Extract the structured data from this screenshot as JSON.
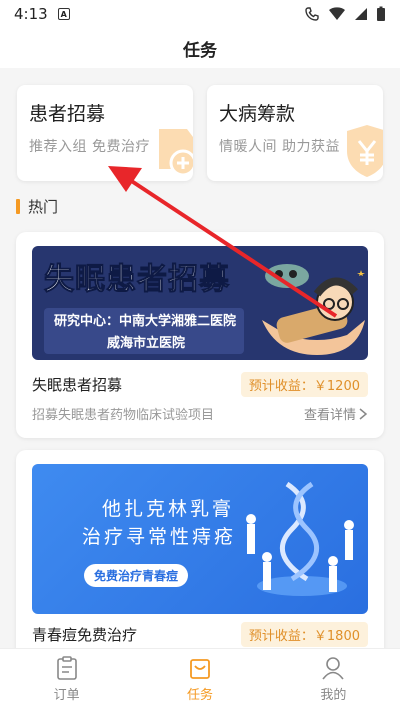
{
  "status_bar": {
    "time": "4:13",
    "notif_letter": "A"
  },
  "page": {
    "title": "任务"
  },
  "categories": [
    {
      "title": "患者招募",
      "subtitle": "推荐入组   免费治疗",
      "icon": "plus-circle-icon"
    },
    {
      "title": "大病筹款",
      "subtitle": "情暖人间   助力获益",
      "icon": "yen-shield-icon"
    }
  ],
  "section": {
    "title": "热门"
  },
  "tasks": [
    {
      "banner": {
        "title": "失眠患者招募",
        "line1": "研究中心：中南大学湘雅二医院",
        "line2": "威海市立医院"
      },
      "name": "失眠患者招募",
      "reward": "预计收益：￥1200",
      "desc": "招募失眠患者药物临床试验项目",
      "detail": "查看详情"
    },
    {
      "banner": {
        "line1": "他扎克林乳膏",
        "line2": "治疗寻常性痔疮",
        "pill": "免费治疗青春痘"
      },
      "name": "青春痘免费治疗",
      "reward": "预计收益：￥1800"
    }
  ],
  "tabbar": {
    "items": [
      {
        "label": "订单",
        "icon": "clipboard-icon"
      },
      {
        "label": "任务",
        "icon": "bag-icon"
      },
      {
        "label": "我的",
        "icon": "person-icon"
      }
    ]
  },
  "colors": {
    "accent": "#f59a23",
    "annotation_arrow": "#e8262a"
  }
}
